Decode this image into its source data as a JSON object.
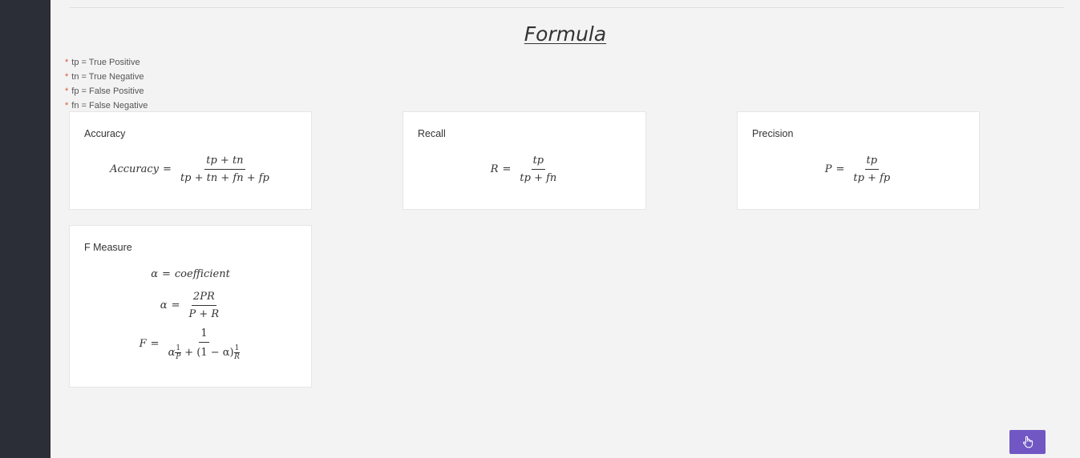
{
  "page": {
    "title": "Formula"
  },
  "legend": [
    {
      "marker": "*",
      "text": "tp = True Positive"
    },
    {
      "marker": "*",
      "text": "tn = True Negative"
    },
    {
      "marker": "*",
      "text": "fp = False Positive"
    },
    {
      "marker": "*",
      "text": "fn = False Negative"
    }
  ],
  "cards": {
    "accuracy": {
      "title": "Accuracy",
      "lhs": "Accuracy",
      "eq": "=",
      "numerator": "tp + tn",
      "denominator": "tp + tn + fn + fp"
    },
    "recall": {
      "title": "Recall",
      "lhs": "R",
      "eq": "=",
      "numerator": "tp",
      "denominator": "tp + fn"
    },
    "precision": {
      "title": "Precision",
      "lhs": "P",
      "eq": "=",
      "numerator": "tp",
      "denominator": "tp + fp"
    },
    "fmeasure": {
      "title": "F Measure",
      "line1_lhs": "α",
      "line1_rhs": "coefficient",
      "line2_lhs": "α",
      "line2_num": "2PR",
      "line2_den": "P + R",
      "line3_lhs": "F",
      "line3_num": "1",
      "line3_alpha": "α",
      "line3_p_num": "1",
      "line3_p_den": "P",
      "line3_mid": "+ (1 − α)",
      "line3_r_num": "1",
      "line3_r_den": "R",
      "eq": "="
    }
  },
  "action_button": {
    "icon": "hand-pointer-icon",
    "color": "#7157c4"
  }
}
